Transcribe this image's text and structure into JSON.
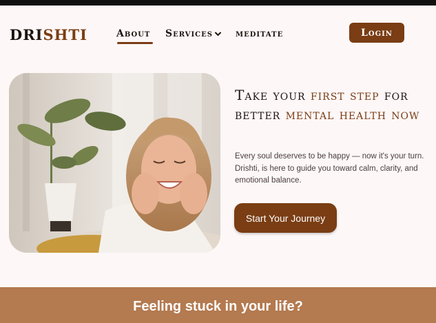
{
  "brand": {
    "logo_part1": "DRI",
    "logo_part2": "SHTI",
    "accent_color": "#7a3d14",
    "text_color": "#1c1410"
  },
  "nav": {
    "items": [
      {
        "label": "About",
        "active": true
      },
      {
        "label": "Services",
        "icon": "chevron-down-icon"
      },
      {
        "label": "meditate"
      }
    ],
    "login_label": "Login"
  },
  "hero": {
    "title_parts": [
      "Take your ",
      "first step",
      " for better ",
      "mental health now"
    ],
    "description": "Every soul deserves to be happy — now it's your turn. Drishti, is here to guide you toward calm, clarity, and emotional balance.",
    "cta_label": "Start Your Journey",
    "image": "smiling-woman-photo"
  },
  "banner": {
    "text": "Feeling stuck in your life?",
    "color": "#b47a50"
  }
}
